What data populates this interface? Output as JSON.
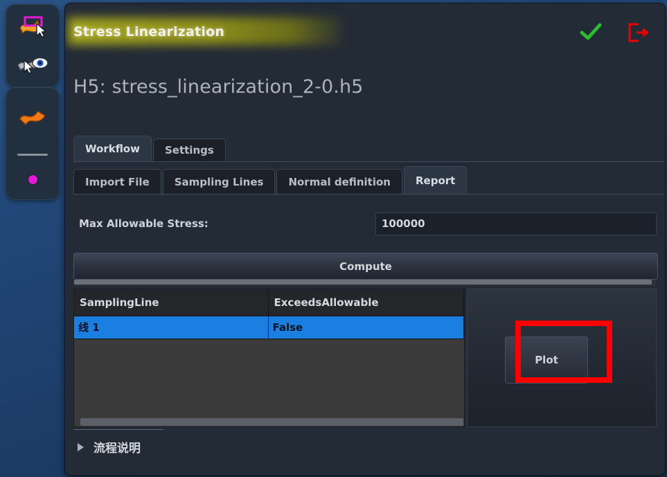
{
  "panel": {
    "title": "Stress Linearization",
    "file_label": "H5: stress_linearization_2-0.h5",
    "accept_icon": "check-icon",
    "accept_color": "#2bbd2b",
    "close_icon": "exit-door-icon",
    "close_color": "#e60000",
    "title_glow_color": "#a8a81e"
  },
  "toolbar": {
    "top": [
      {
        "icon": "surface-select-icon",
        "label": "Select surface"
      },
      {
        "icon": "surface-visibility-icon",
        "label": "Toggle surface visibility"
      }
    ],
    "bottom": [
      {
        "icon": "surface-icon",
        "label": "Surface"
      },
      {
        "icon": "line-icon",
        "label": "Line"
      },
      {
        "icon": "point-icon",
        "label": "Point"
      }
    ],
    "accent_magenta": "#e618d8",
    "accent_orange": "#ef8a1c"
  },
  "tabs": {
    "main": [
      {
        "label": "Workflow",
        "active": true
      },
      {
        "label": "Settings",
        "active": false
      }
    ],
    "sub": [
      {
        "label": "Import File",
        "active": false
      },
      {
        "label": "Sampling Lines",
        "active": false
      },
      {
        "label": "Normal definition",
        "active": false
      },
      {
        "label": "Report",
        "active": true
      }
    ]
  },
  "form": {
    "stress_label": "Max Allowable Stress:",
    "stress_value": "100000",
    "stress_placeholder": "100000"
  },
  "actions": {
    "compute_label": "Compute",
    "plot_label": "Plot"
  },
  "table": {
    "columns": [
      "SamplingLine",
      "ExceedsAllowable"
    ],
    "rows": [
      {
        "sampling_line": "线 1",
        "exceeds_allowable": "False",
        "selected": true
      }
    ],
    "selected_row_color": "#1a7fe0"
  },
  "bottom": {
    "collapse_label": "流程说明",
    "collapse_caret": "caret-right-icon",
    "expanded": false
  },
  "annotation": {
    "highlight_shape": "rectangle",
    "highlight_color": "#fe0000",
    "highlight_target": "Plot"
  }
}
